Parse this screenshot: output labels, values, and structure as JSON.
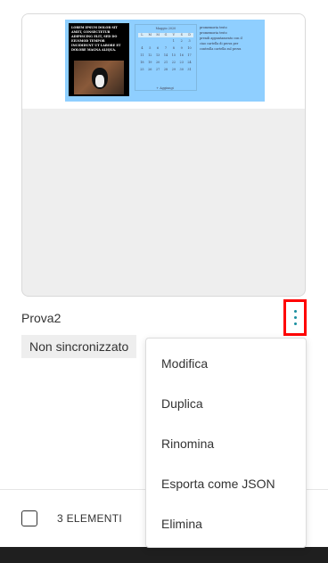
{
  "card": {
    "thumbnail": {
      "intro_text": "LOREM IPSUM DOLOR SIT AMET, CONSECTETUR ADIPISCING ELIT, SED DO EIUSMOD TEMPOR INCIDIDUNT UT LABORE ET DOLORE MAGNA ALIQUA.",
      "calendar_title": "Maggio 2020",
      "weekdays": [
        "L",
        "M",
        "M",
        "G",
        "V",
        "S",
        "D"
      ],
      "days": [
        "",
        "",
        "",
        "",
        "1",
        "2",
        "3",
        "4",
        "5",
        "6",
        "7",
        "8",
        "9",
        "10",
        "11",
        "12",
        "13",
        "14",
        "15",
        "16",
        "17",
        "18",
        "19",
        "20",
        "21",
        "22",
        "23",
        "24",
        "25",
        "26",
        "27",
        "28",
        "29",
        "30",
        "31"
      ],
      "calendar_footer": "+ Aggiungi",
      "notes": [
        "promemoria testo",
        "promemoria testo",
        "prendi appuntamento con il",
        "ciao cartella di prova per",
        "controlla cartella sul prova"
      ]
    },
    "title": "Prova2",
    "status_badge": "Non sincronizzato"
  },
  "menu": {
    "items": [
      "Modifica",
      "Duplica",
      "Rinomina",
      "Esporta come JSON",
      "Elimina"
    ]
  },
  "footer": {
    "count_label": "3 ELEMENTI"
  },
  "colors": {
    "thumbnail_bg": "#8fcfff",
    "highlight_border": "#ff0000",
    "kebab_dots": "#1a8fa0"
  }
}
